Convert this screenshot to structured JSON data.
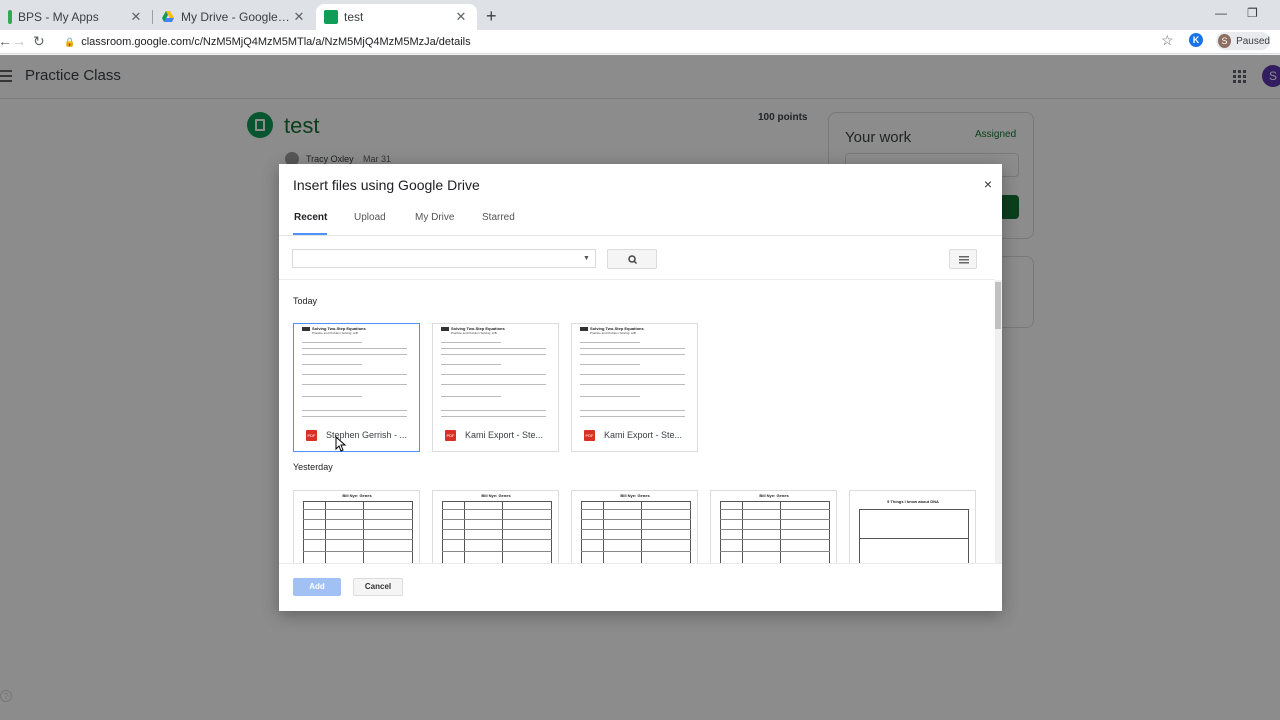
{
  "browser": {
    "tabs": [
      {
        "title": "BPS - My Apps",
        "favicon": "app-icon"
      },
      {
        "title": "My Drive - Google Drive",
        "favicon": "google-drive-icon"
      },
      {
        "title": "test",
        "favicon": "classroom-icon"
      }
    ],
    "url": "classroom.google.com/c/NzM5MjQ4MzM5MTla/a/NzM5MjQ4MzM5MzJa/details",
    "profile_initial": "S",
    "profile_status": "Paused",
    "extension_initial": "K"
  },
  "classroom": {
    "class_name": "Practice Class",
    "assignment_title": "test",
    "points": "100 points",
    "teacher": "Tracy Oxley",
    "date": "Mar 31",
    "your_work": "Your work",
    "status": "Assigned",
    "avatar_initial": "S"
  },
  "dialog": {
    "title": "Insert files using Google Drive",
    "close_label": "×",
    "tabs": [
      "Recent",
      "Upload",
      "My Drive",
      "Starred"
    ],
    "search": {
      "value": "",
      "placeholder": ""
    },
    "sections": {
      "today": "Today",
      "yesterday": "Yesterday"
    },
    "today_files": [
      {
        "name": "Stephen Gerrish - ...",
        "type": "PDF",
        "doc_title": "Solving Two-Step Equations",
        "doc_subtitle": "Practice and Problem Solving: A/B"
      },
      {
        "name": "Kami Export - Ste...",
        "type": "PDF",
        "doc_title": "Solving Two-Step Equations",
        "doc_subtitle": "Practice and Problem Solving: A/B"
      },
      {
        "name": "Kami Export - Ste...",
        "type": "PDF",
        "doc_title": "Solving Two-Step Equations",
        "doc_subtitle": "Practice and Problem Solving: A/B"
      }
    ],
    "yesterday_files": [
      {
        "doc_title": "Bill Nye: Genes"
      },
      {
        "doc_title": "Bill Nye: Genes"
      },
      {
        "doc_title": "Bill Nye: Genes"
      },
      {
        "doc_title": "Bill Nye: Genes"
      },
      {
        "doc_title": "5 Things I know about DNA"
      }
    ],
    "add_label": "Add",
    "cancel_label": "Cancel"
  }
}
